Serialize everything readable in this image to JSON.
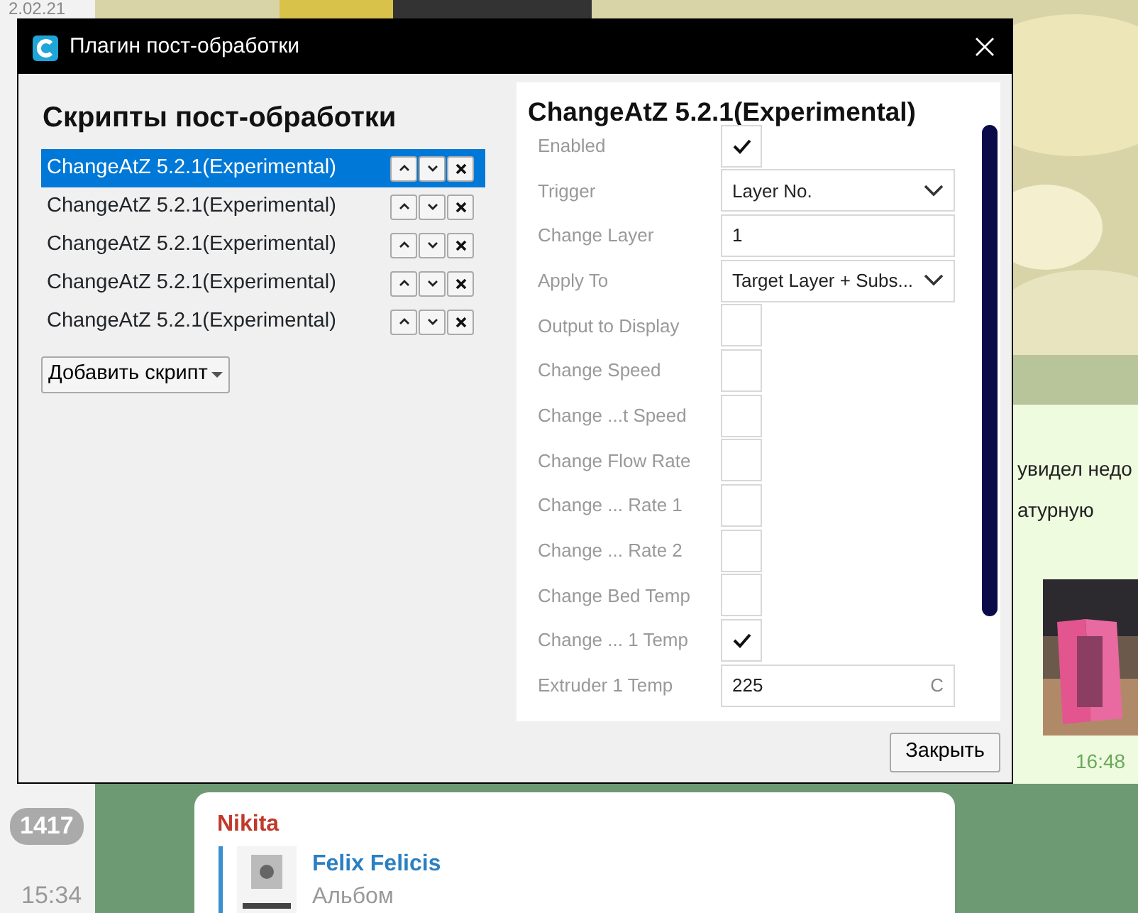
{
  "chat": {
    "dates": [
      {
        "text": "2.02.21"
      }
    ],
    "incoming": {
      "text_lines": [
        "увидел недо",
        "атурную"
      ],
      "time": "16:48",
      "kind": "picture"
    },
    "side_badge": "1417",
    "side_time": "15:34",
    "message": {
      "sender": "Nikita",
      "reply_title": "Felix Felicis",
      "reply_subtitle": "Альбом"
    }
  },
  "window": {
    "title": "Плагин пост-обработки",
    "scripts": {
      "heading": "Скрипты пост-обработки",
      "items": [
        {
          "label": "ChangeAtZ 5.2.1(Experimental)",
          "selected": true
        },
        {
          "label": "ChangeAtZ 5.2.1(Experimental)",
          "selected": false
        },
        {
          "label": "ChangeAtZ 5.2.1(Experimental)",
          "selected": false
        },
        {
          "label": "ChangeAtZ 5.2.1(Experimental)",
          "selected": false
        },
        {
          "label": "ChangeAtZ 5.2.1(Experimental)",
          "selected": false
        }
      ],
      "add_button": "Добавить скрипт"
    },
    "settings": {
      "heading": "ChangeAtZ 5.2.1(Experimental)",
      "rows": [
        {
          "kind": "checkbox",
          "label": "Enabled",
          "checked": true
        },
        {
          "kind": "select",
          "label": "Trigger",
          "value": "Layer No."
        },
        {
          "kind": "text",
          "label": "Change Layer",
          "value": "1"
        },
        {
          "kind": "select",
          "label": "Apply To",
          "value": "Target Layer + Subs..."
        },
        {
          "kind": "checkbox",
          "label": "Output to Display",
          "checked": false
        },
        {
          "kind": "checkbox",
          "label": "Change Speed",
          "checked": false
        },
        {
          "kind": "checkbox",
          "label": "Change ...t Speed",
          "checked": false
        },
        {
          "kind": "checkbox",
          "label": "Change Flow Rate",
          "checked": false
        },
        {
          "kind": "checkbox",
          "label": "Change ... Rate 1",
          "checked": false
        },
        {
          "kind": "checkbox",
          "label": "Change ... Rate 2",
          "checked": false
        },
        {
          "kind": "checkbox",
          "label": "Change Bed Temp",
          "checked": false
        },
        {
          "kind": "checkbox",
          "label": "Change ... 1 Temp",
          "checked": true
        },
        {
          "kind": "text",
          "label": "Extruder 1 Temp",
          "value": "225",
          "unit": "C"
        }
      ]
    },
    "close_button": "Закрыть"
  }
}
